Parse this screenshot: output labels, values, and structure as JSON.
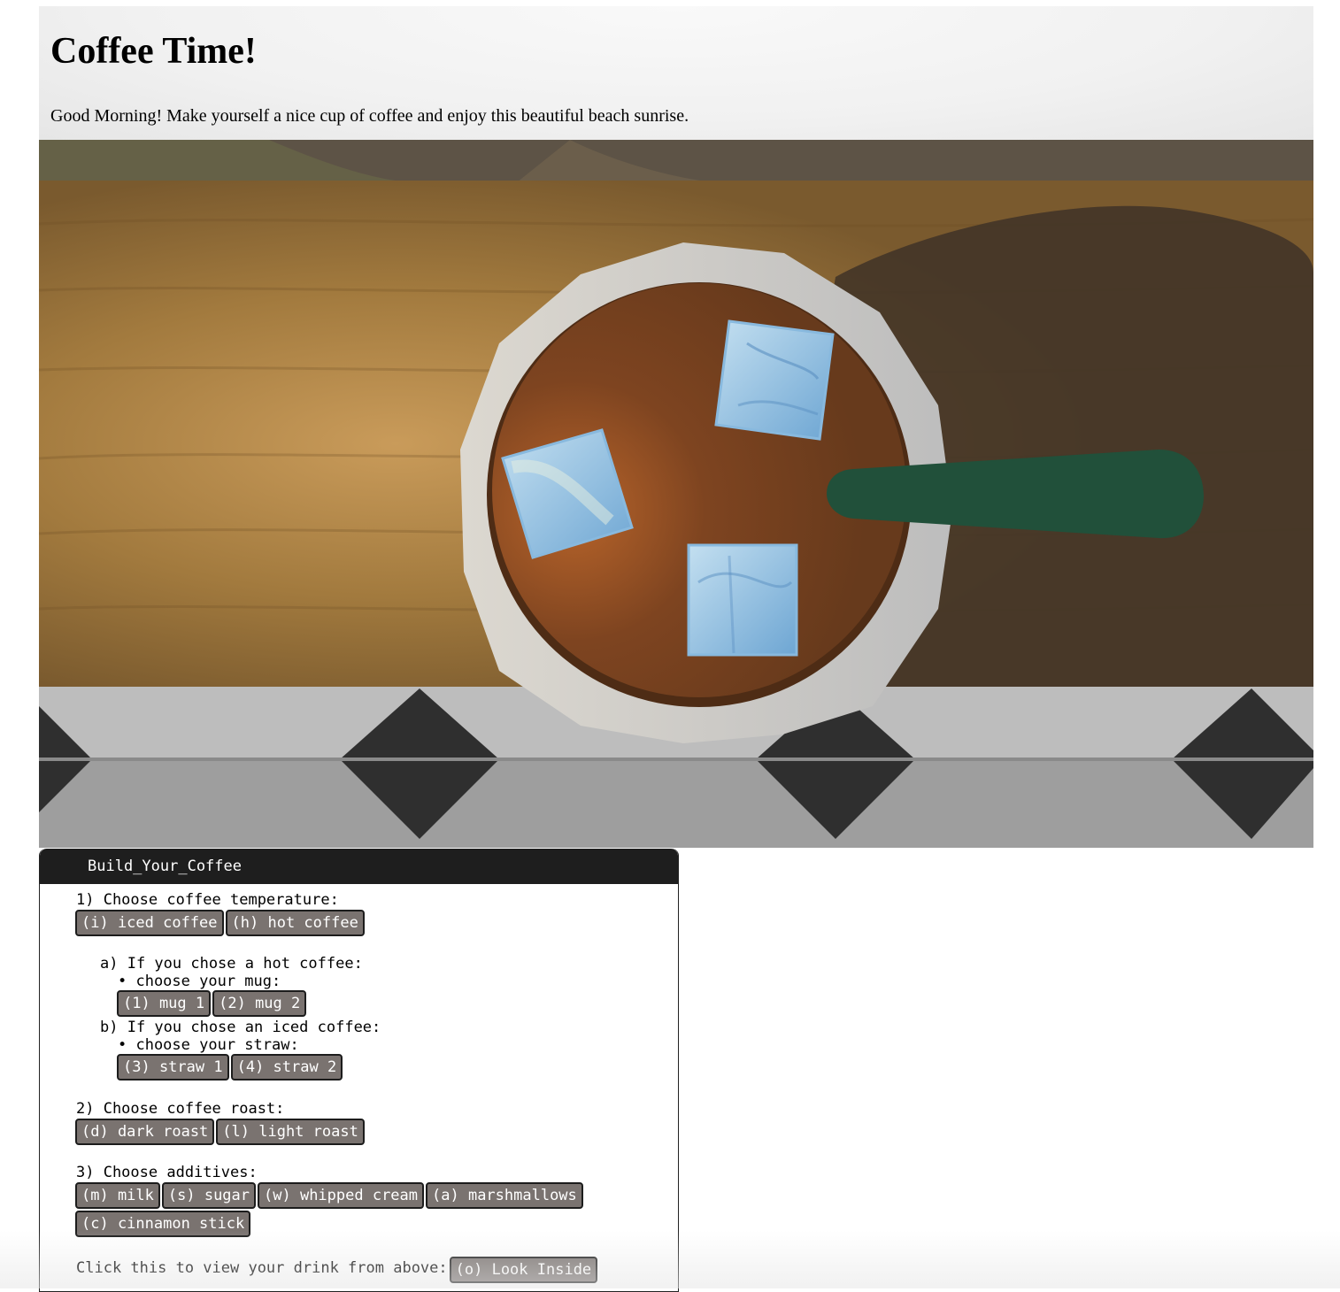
{
  "header": {
    "title": "Coffee Time!",
    "subtitle": "Good Morning! Make yourself a nice cup of coffee and enjoy this beautiful beach sunrise."
  },
  "scene": {
    "description_icon": "coffee-cup-top-view",
    "ice_cube_count": 3,
    "straw_color": "#23513a",
    "coffee_color": "#7a4420",
    "table_color": "#b08548",
    "floor_tile_color": "#333333"
  },
  "panel": {
    "title": "Build_Your_Coffee",
    "step1_label": "1) Choose coffee temperature:",
    "step1_buttons": [
      "(i) iced coffee",
      "(h) hot coffee"
    ],
    "sub_a_label": "a) If you chose a hot coffee:",
    "sub_a_bullet": "• choose your mug:",
    "sub_a_buttons": [
      "(1) mug 1",
      "(2) mug 2"
    ],
    "sub_b_label": "b) If you chose an iced coffee:",
    "sub_b_bullet": "• choose your straw:",
    "sub_b_buttons": [
      "(3) straw 1",
      "(4) straw 2"
    ],
    "step2_label": "2) Choose coffee roast:",
    "step2_buttons": [
      "(d) dark roast",
      "(l) light roast"
    ],
    "step3_label": "3) Choose additives:",
    "step3_buttons_row1": [
      "(m) milk",
      "(s) sugar",
      "(w) whipped cream",
      "(a) marshmallows"
    ],
    "step3_buttons_row2": [
      "(c) cinnamon stick"
    ],
    "look_label": "Click this to view your drink from above:",
    "look_button": "(o) Look Inside"
  }
}
